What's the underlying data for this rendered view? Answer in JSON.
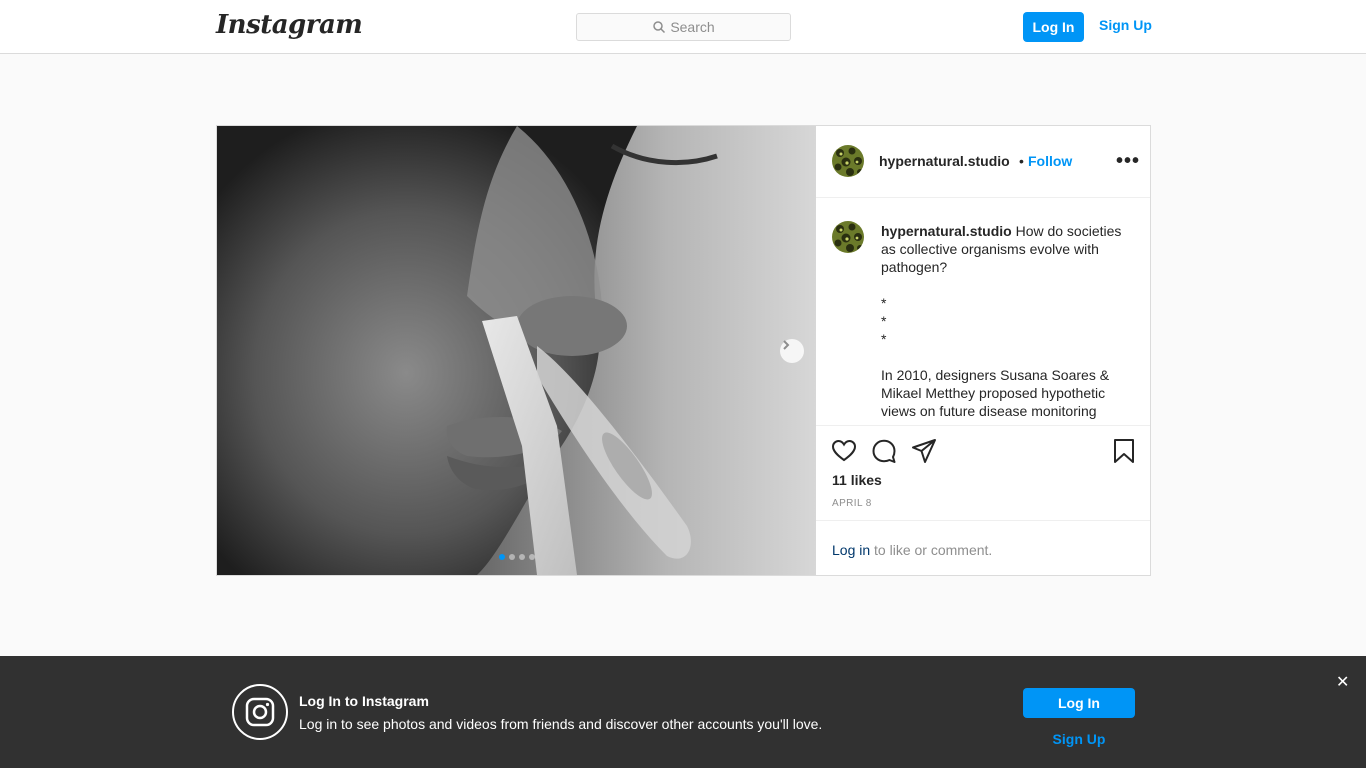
{
  "nav": {
    "logo": "Instagram",
    "search_placeholder": "Search",
    "login_label": "Log In",
    "signup_label": "Sign Up"
  },
  "post": {
    "username": "hypernatural.studio",
    "separator": "•",
    "follow_label": "Follow",
    "more_label": "•••",
    "caption_user": "hypernatural.studio",
    "caption_lines": [
      "How do societies as collective organisms evolve with pathogen?",
      "*",
      "*",
      "*",
      "In 2010, designers Susana Soares & Mikael Metthey proposed hypothetic views on future disease monitoring"
    ],
    "likes": "11 likes",
    "date": "APRIL 8",
    "login_link": "Log in",
    "login_suffix": " to like or comment.",
    "carousel_total": 4,
    "carousel_current": 1
  },
  "banner": {
    "title": "Log In to Instagram",
    "subtitle": "Log in to see photos and videos from friends and discover other accounts you'll love.",
    "login_label": "Log In",
    "signup_label": "Sign Up",
    "close_label": "✕"
  },
  "colors": {
    "accent": "#0095f6",
    "text": "#262626",
    "muted": "#8e8e8e",
    "border": "#dbdbdb",
    "banner_bg": "#262626"
  }
}
